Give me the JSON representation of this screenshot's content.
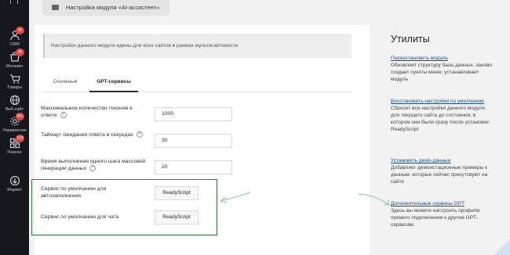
{
  "sidebar": {
    "items": [
      {
        "label": "CRM",
        "badge": "85",
        "icon": "crm-icon"
      },
      {
        "label": "Магазин",
        "badge": "45",
        "icon": "shop-icon"
      },
      {
        "label": "Товары",
        "badge": "",
        "icon": "products-icon"
      },
      {
        "label": "Веб-сайт",
        "badge": "",
        "icon": "website-icon"
      },
      {
        "label": "Управление",
        "badge": "99+",
        "icon": "management-icon"
      },
      {
        "label": "Разное",
        "badge": "122",
        "icon": "misc-icon"
      },
      {
        "label": "Маркет",
        "badge": "",
        "icon": "market-icon"
      }
    ]
  },
  "header": {
    "module_title": "Настройка модуля «AI-ассистент»"
  },
  "notice": "Настройки данного модуля едины для всех сайтов в рамках мультисайтовости",
  "tabs": [
    "Основные",
    "GPT-сервисы"
  ],
  "fields": {
    "max_tokens": {
      "label": "Максимальное количество токенов в ответе",
      "value": "1000"
    },
    "timeout": {
      "label": "Таймаут ожидания ответа в секундах",
      "value": "30"
    },
    "mass_time": {
      "label": "Время выполнения одного шага массовой генерации данных",
      "value": "20"
    },
    "default_autofill": {
      "label": "Сервис по умолчанию для автозаполнения",
      "value": "ReadyScript"
    },
    "default_chat": {
      "label": "Сервис по умолчанию для чата",
      "value": "ReadyScript"
    },
    "help_glyph": "?"
  },
  "utilities": {
    "title": "Утилиты",
    "items": [
      {
        "link": "Переустановить модуль",
        "desc": "Обновляет структуру базы данных, заново создает пункты меню, устанавливает модуль"
      },
      {
        "link": "Восстановить настройки по умолчанию",
        "desc": "Сбросит все настройки данного модуля для текущего сайта до состояния, в котором они были сразу после установки ReadyScript"
      },
      {
        "link": "Установить демо-данные",
        "desc": "Добавляет демонстационные примеры к данным, которые сейчас присутсвуют на сайте"
      },
      {
        "link": "Дополнительные сервисы GPT",
        "desc": "Здесь вы можете настроить профили прямого подключения к другим GPT-сервисам."
      }
    ]
  },
  "colors": {
    "highlight": "#2e7d32",
    "link": "#1b4e9c",
    "badge": "#e3413b"
  }
}
